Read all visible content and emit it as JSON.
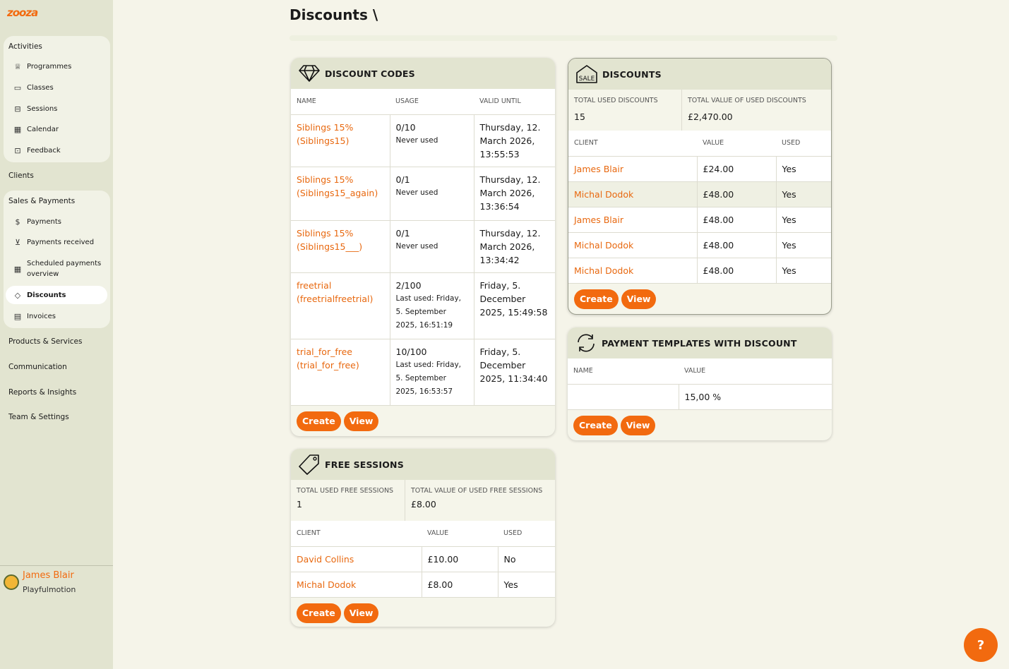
{
  "app": {
    "logo_text": "zooza",
    "accent_color": "#f26a0f"
  },
  "sidebar": {
    "activities": {
      "title": "Activities",
      "items": [
        {
          "label": "Programmes",
          "icon": "trophy-icon"
        },
        {
          "label": "Classes",
          "icon": "folder-icon"
        },
        {
          "label": "Sessions",
          "icon": "ticket-icon"
        },
        {
          "label": "Calendar",
          "icon": "calendar-icon"
        },
        {
          "label": "Feedback",
          "icon": "feedback-icon"
        }
      ]
    },
    "clients_label": "Clients",
    "sales": {
      "title": "Sales & Payments",
      "items": [
        {
          "label": "Payments",
          "icon": "coin-icon"
        },
        {
          "label": "Payments received",
          "icon": "cart-icon"
        },
        {
          "label": "Scheduled payments overview",
          "icon": "calendar-grid-icon"
        },
        {
          "label": "Discounts",
          "icon": "tag-icon"
        },
        {
          "label": "Invoices",
          "icon": "invoice-icon"
        }
      ]
    },
    "links": [
      "Products & Services",
      "Communication",
      "Reports & Insights",
      "Team & Settings"
    ],
    "user": {
      "name": "James Blair",
      "org": "Playfulmotion"
    }
  },
  "page": {
    "title": "Discounts \\"
  },
  "discount_codes": {
    "title": "DISCOUNT CODES",
    "columns": [
      "NAME",
      "USAGE",
      "VALID UNTIL"
    ],
    "rows": [
      {
        "name": "Siblings 15% (Siblings15)",
        "usage": "0/10",
        "usage_note": "Never used",
        "valid": "Thursday, 12. March 2026, 13:55:53"
      },
      {
        "name": "Siblings 15% (Siblings15_again)",
        "usage": "0/1",
        "usage_note": "Never used",
        "valid": "Thursday, 12. March 2026, 13:36:54"
      },
      {
        "name": "Siblings 15% (Siblings15___)",
        "usage": "0/1",
        "usage_note": "Never used",
        "valid": "Thursday, 12. March 2026, 13:34:42"
      },
      {
        "name": "freetrial (freetrialfreetrial)",
        "usage": "2/100",
        "usage_note": "Last used: Friday, 5. September 2025, 16:51:19",
        "valid": "Friday, 5. December 2025, 15:49:58"
      },
      {
        "name": "trial_for_free (trial_for_free)",
        "usage": "10/100",
        "usage_note": "Last used: Friday, 5. September 2025, 16:53:57",
        "valid": "Friday, 5. December 2025, 11:34:40"
      }
    ],
    "create_label": "Create",
    "view_label": "View"
  },
  "discounts": {
    "title": "DISCOUNTS",
    "total_used_label": "TOTAL USED DISCOUNTS",
    "total_used_value": "15",
    "total_value_label": "TOTAL VALUE OF USED DISCOUNTS",
    "total_value_value": "£2,470.00",
    "columns": [
      "CLIENT",
      "VALUE",
      "USED"
    ],
    "rows": [
      {
        "client": "James Blair",
        "value": "£24.00",
        "used": "Yes"
      },
      {
        "client": "Michal Dodok",
        "value": "£48.00",
        "used": "Yes"
      },
      {
        "client": "James Blair",
        "value": "£48.00",
        "used": "Yes"
      },
      {
        "client": "Michal Dodok",
        "value": "£48.00",
        "used": "Yes"
      },
      {
        "client": "Michal Dodok",
        "value": "£48.00",
        "used": "Yes"
      }
    ],
    "create_label": "Create",
    "view_label": "View"
  },
  "payment_templates": {
    "title": "PAYMENT TEMPLATES WITH DISCOUNT",
    "columns": [
      "NAME",
      "VALUE"
    ],
    "rows": [
      {
        "name": "",
        "value": "15,00 %"
      }
    ],
    "create_label": "Create",
    "view_label": "View"
  },
  "free_sessions": {
    "title": "FREE SESSIONS",
    "total_used_label": "TOTAL USED FREE SESSIONS",
    "total_used_value": "1",
    "total_value_label": "TOTAL VALUE OF USED FREE SESSIONS",
    "total_value_value": "£8.00",
    "columns": [
      "CLIENT",
      "VALUE",
      "USED"
    ],
    "rows": [
      {
        "client": "David Collins",
        "value": "£10.00",
        "used": "No"
      },
      {
        "client": "Michal Dodok",
        "value": "£8.00",
        "used": "Yes"
      }
    ],
    "create_label": "Create",
    "view_label": "View"
  },
  "help": {
    "icon": "help-icon",
    "glyph": "?"
  }
}
